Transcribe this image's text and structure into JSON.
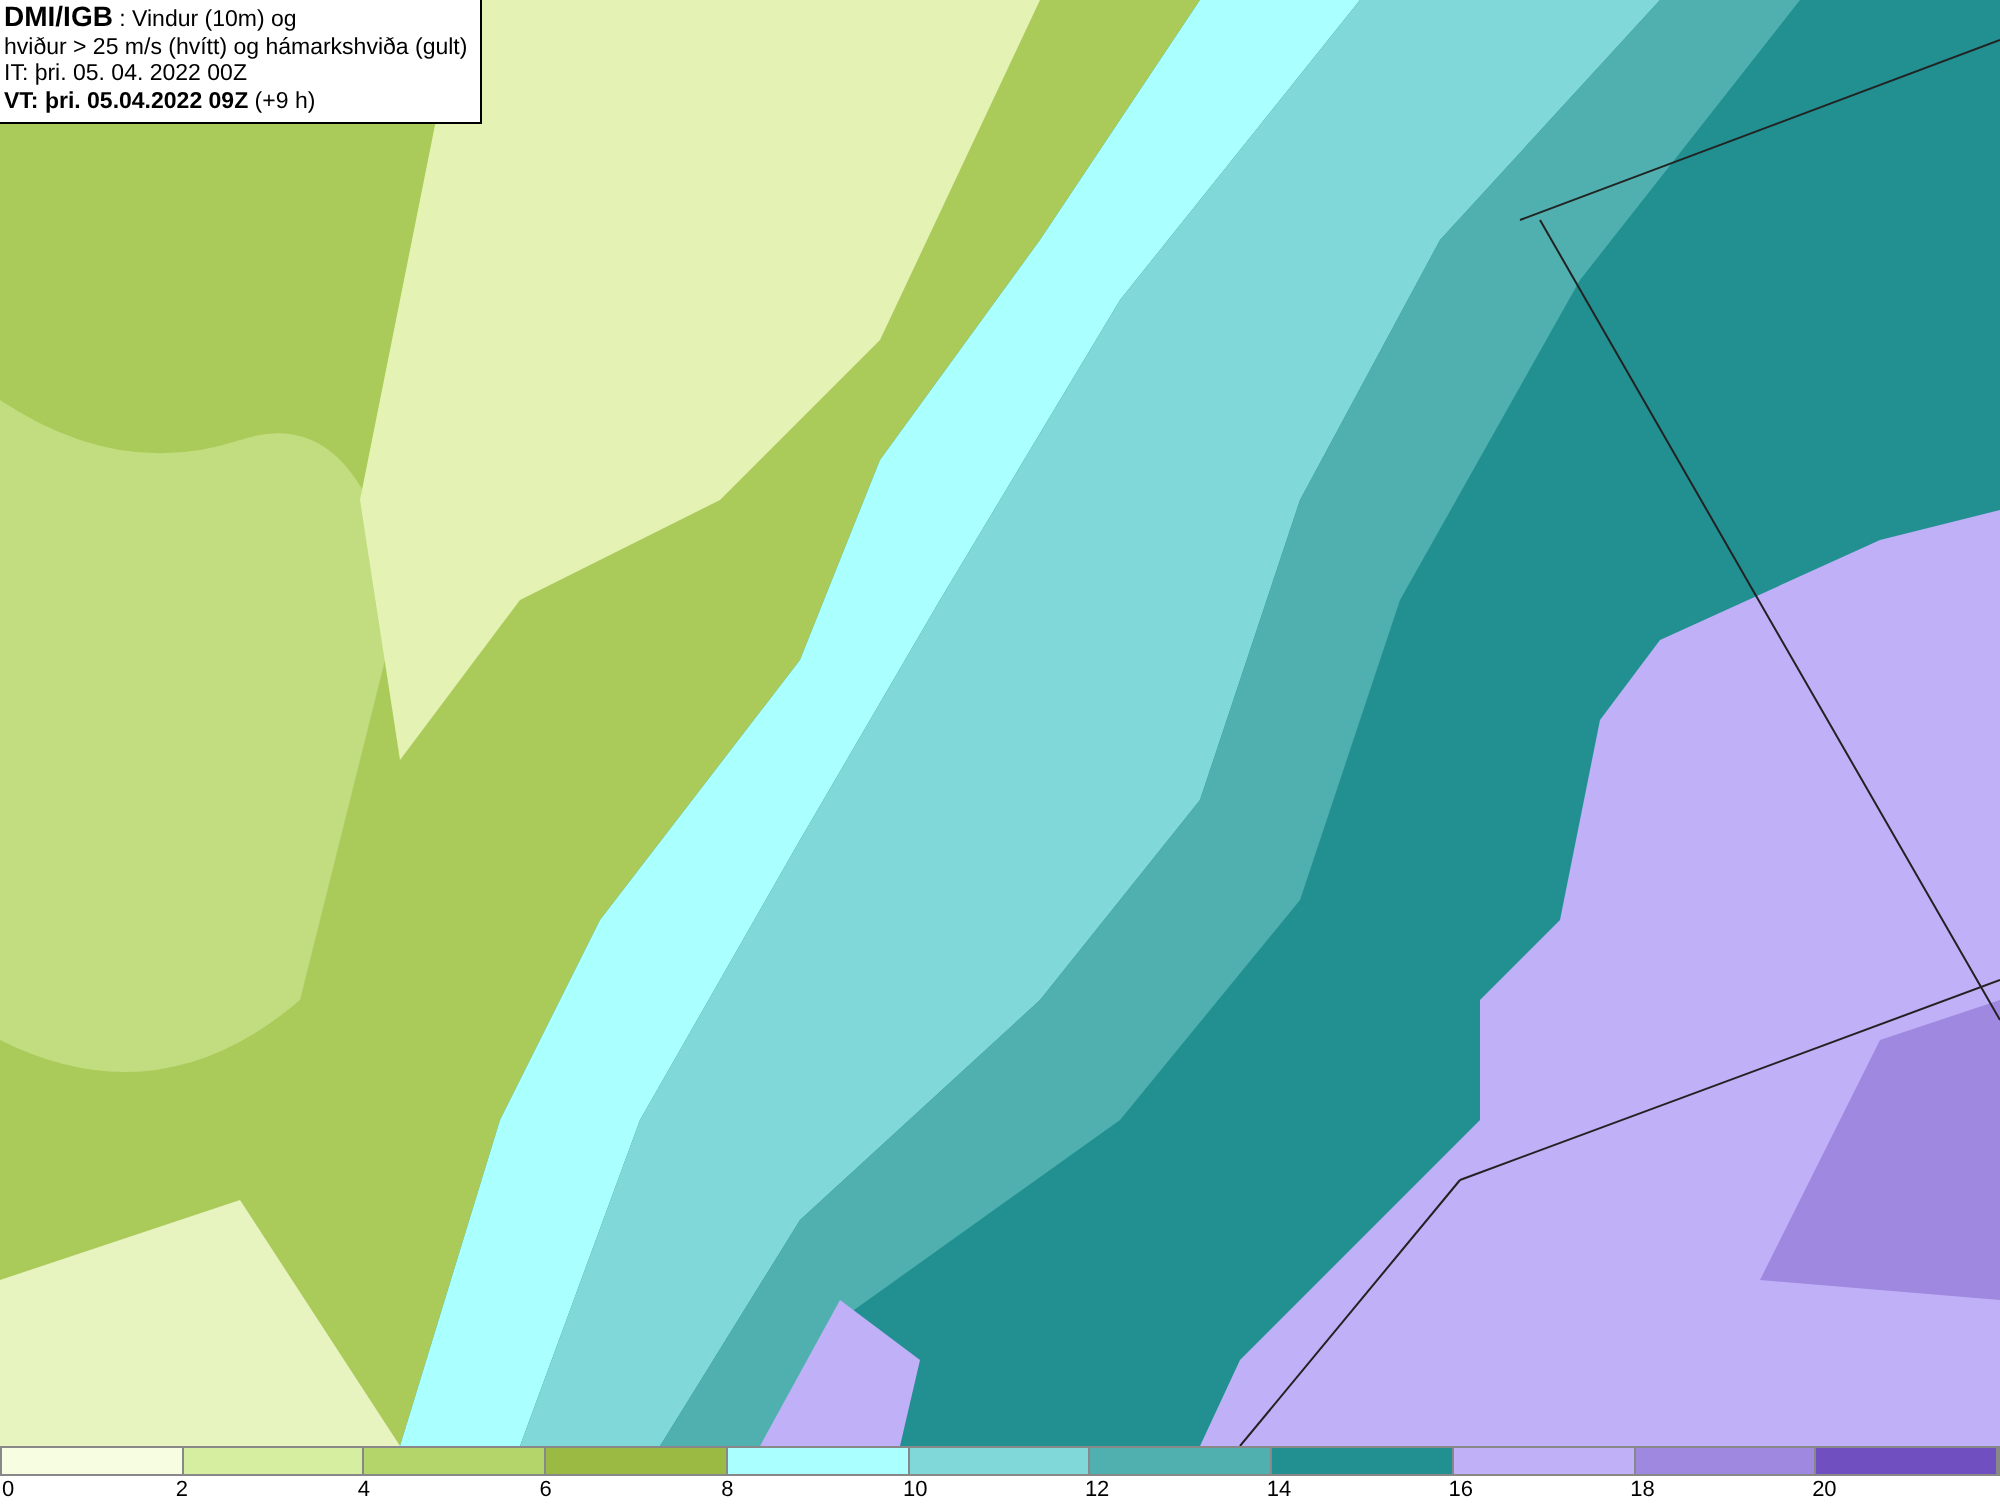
{
  "caption": {
    "lines": [
      "**DMI/IGB** : Vindur (10m) og",
      "hviður > 25 m/s (hvítt) og hámarkshviða (gult)",
      "IT: þri. 05. 04. 2022 00Z",
      "**VT: þri. 05.04.2022 09Z** (+9 h)"
    ]
  },
  "legend": {
    "bins": [
      {
        "color": "#f7fde0",
        "label": "0"
      },
      {
        "color": "#d6eea0",
        "label": "2"
      },
      {
        "color": "#b4d56a",
        "label": "4"
      },
      {
        "color": "#9aba44",
        "label": "6"
      },
      {
        "color": "#aaffff",
        "label": "8"
      },
      {
        "color": "#80d8d8",
        "label": "10"
      },
      {
        "color": "#50b0b0",
        "label": "12"
      },
      {
        "color": "#229090",
        "label": "14"
      },
      {
        "color": "#c0b0f8",
        "label": "16"
      },
      {
        "color": "#9f88e0",
        "label": "18"
      },
      {
        "color": "#7050c0",
        "label": "20"
      }
    ]
  }
}
